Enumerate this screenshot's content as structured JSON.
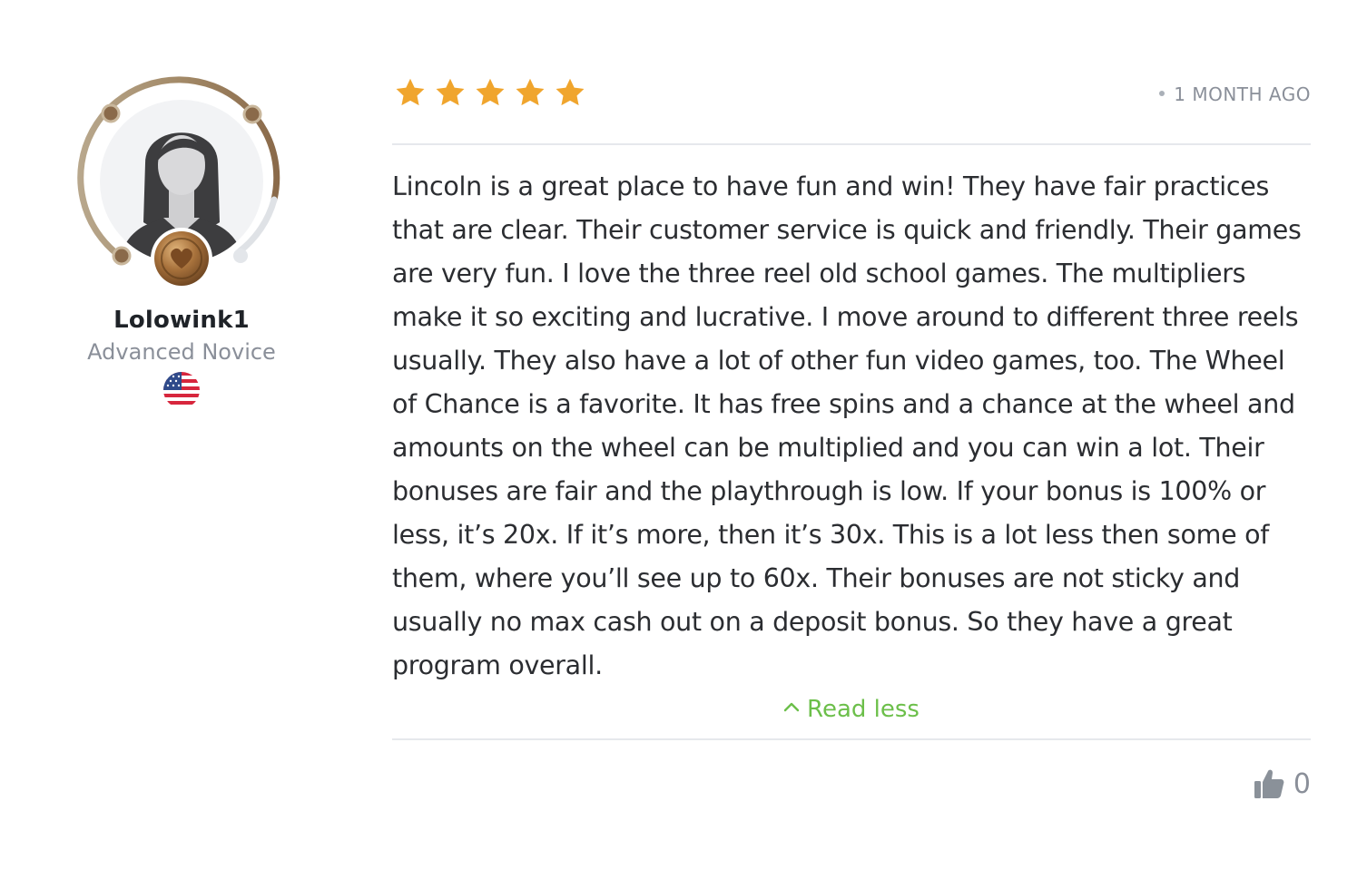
{
  "reviewer": {
    "username": "Lolowink1",
    "level": "Advanced Novice",
    "country_flag": "us-flag-icon",
    "badge": "heart-medal-icon"
  },
  "review": {
    "rating": 5,
    "rating_max": 5,
    "time_ago": "1 MONTH AGO",
    "text": "Lincoln is a great place to have fun and win! They have fair practices that are clear. Their customer service is quick and friendly. Their games are very fun. I love the three reel old school games. The multipliers make it so exciting and lucrative. I move around to different three reels usually. They also have a lot of other fun video games, too. The Wheel of Chance is a favorite. It has free spins and a chance at the wheel and amounts on the wheel can be multiplied and you can win a lot. Their bonuses are fair and the playthrough is low. If your bonus is 100% or less, it’s 20x. If it’s more, then it’s 30x. This is a lot less then some of them, where you’ll see up to 60x. Their bonuses are not sticky and usually no max cash out on a deposit bonus. So they have a great program overall.",
    "read_less_label": "Read less",
    "likes": "0"
  },
  "colors": {
    "star": "#f0a52d",
    "accent_green": "#6cbf4a",
    "muted_text": "#8a8f99",
    "divider": "#e6e8ec",
    "thumb": "#8a9199"
  }
}
